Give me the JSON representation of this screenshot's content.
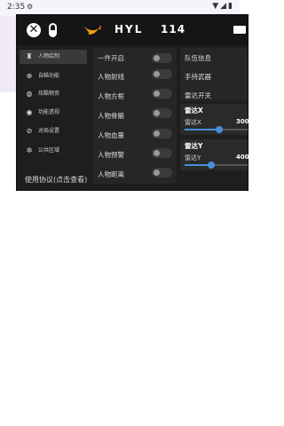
{
  "status_bar": {
    "time": "2:35",
    "settings_icon": "gear-icon",
    "icons": [
      "wifi-icon",
      "signal-icon",
      "battery-icon"
    ]
  },
  "header": {
    "title": "HYL",
    "number": "114",
    "logo_icons": [
      "x-circle-icon",
      "pill-icon",
      "swift-bird-icon"
    ],
    "folder_icon": "folder-icon"
  },
  "sidebar": {
    "items": [
      {
        "label": "人物绘制",
        "icon": "person-icon",
        "active": true
      },
      {
        "label": "自瞄功能",
        "icon": "crosshair-icon",
        "active": false
      },
      {
        "label": "炫酷物资",
        "icon": "globe-icon",
        "active": false
      },
      {
        "label": "功能透视",
        "icon": "eye-icon",
        "active": false
      },
      {
        "label": "对局设置",
        "icon": "compass-icon",
        "active": false
      },
      {
        "label": "公共区域",
        "icon": "gear-icon",
        "active": false
      }
    ],
    "usage_text": "使用协议(点击查看)"
  },
  "toggles_col1": [
    {
      "label": "一件开启",
      "on": false
    },
    {
      "label": "人物射线",
      "on": false
    },
    {
      "label": "人物方框",
      "on": false
    },
    {
      "label": "人物骨骼",
      "on": false
    },
    {
      "label": "人物血量",
      "on": false
    },
    {
      "label": "人物预警",
      "on": false
    },
    {
      "label": "人物距离",
      "on": false
    }
  ],
  "toggles_col2": [
    {
      "label": "队伍信息"
    },
    {
      "label": "手持武器"
    },
    {
      "label": "雷达开关"
    }
  ],
  "radar_x": {
    "title": "雷达X",
    "label": "雷达X",
    "value": "300",
    "fraction": 0.55
  },
  "radar_y": {
    "title": "雷达Y",
    "label": "雷达Y",
    "value": "400",
    "fraction": 0.42
  },
  "colors": {
    "panel_bg": "#1e1e1e",
    "header_bg": "#151515",
    "accent": "#f39c12",
    "slider": "#4a8fd8"
  }
}
